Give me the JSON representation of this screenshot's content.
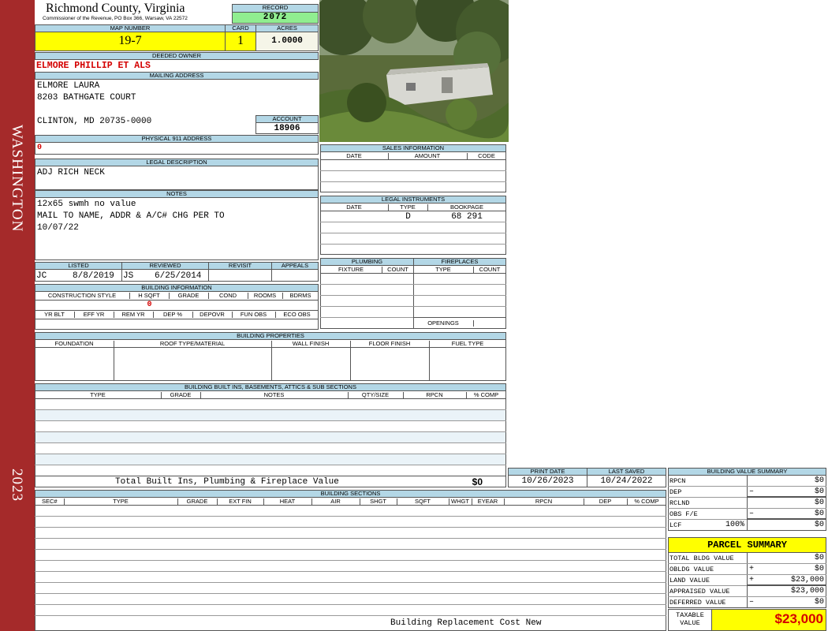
{
  "side_bar": {
    "district": "WASHINGTON",
    "year": "2023"
  },
  "header": {
    "county": "Richmond County, Virginia",
    "commissioner": "Commissioner of the Revenue, PO Box 366, Warsaw, VA 22572",
    "record_label": "RECORD",
    "record": "2072"
  },
  "parcel": {
    "map_label": "MAP NUMBER",
    "map": "19-7",
    "card_label": "CARD",
    "card": "1",
    "acres_label": "ACRES",
    "acres": "1.0000"
  },
  "owner": {
    "deeded_label": "DEEDED OWNER",
    "deeded": "ELMORE PHILLIP ET ALS",
    "mailing_label": "MAILING ADDRESS",
    "line1": "ELMORE LAURA",
    "line2": "8203 BATHGATE COURT",
    "line3": "CLINTON, MD 20735-0000",
    "account_label": "ACCOUNT",
    "account": "18906",
    "physical_label": "PHYSICAL 911 ADDRESS",
    "physical": "0"
  },
  "legal": {
    "label": "LEGAL DESCRIPTION",
    "text": "ADJ RICH NECK"
  },
  "notes": {
    "label": "NOTES",
    "line1": "12x65 swmh no value",
    "line2": "MAIL TO NAME, ADDR & A/C# CHG PER TO",
    "line3": "10/07/22"
  },
  "review": {
    "listed_label": "LISTED",
    "reviewed_label": "REVIEWED",
    "revisit_label": "REVISIT",
    "appeals_label": "APPEALS",
    "listed_by": "JC",
    "listed_date": "8/8/2019",
    "reviewed_by": "JS",
    "reviewed_date": "6/25/2014"
  },
  "building_info": {
    "label": "BUILDING INFORMATION",
    "cols1": [
      "CONSTRUCTION STYLE",
      "H SQFT",
      "GRADE",
      "COND",
      "ROOMS",
      "BDRMS"
    ],
    "hsqft": "0",
    "cols2": [
      "YR BLT",
      "EFF YR",
      "REM YR",
      "DEP %",
      "DEPOVR",
      "FUN OBS",
      "ECO OBS"
    ]
  },
  "sales": {
    "label": "SALES INFORMATION",
    "cols": [
      "DATE",
      "AMOUNT",
      "CODE"
    ]
  },
  "legal_instruments": {
    "label": "LEGAL INSTRUMENTS",
    "cols": [
      "DATE",
      "TYPE",
      "BOOKPAGE"
    ],
    "type": "D",
    "bookpage": "68 291"
  },
  "plumbing": {
    "label": "PLUMBING",
    "cols": [
      "FIXTURE",
      "COUNT"
    ]
  },
  "fireplaces": {
    "label": "FIREPLACES",
    "cols": [
      "TYPE",
      "COUNT"
    ],
    "openings": "OPENINGS"
  },
  "building_properties": {
    "label": "BUILDING PROPERTIES",
    "cols": [
      "FOUNDATION",
      "ROOF TYPE/MATERIAL",
      "WALL FINISH",
      "FLOOR FINISH",
      "FUEL TYPE"
    ]
  },
  "builtins": {
    "label": "BUILDING BUILT INS, BASEMENTS, ATTICS & SUB SECTIONS",
    "cols": [
      "TYPE",
      "GRADE",
      "NOTES",
      "QTY/SIZE",
      "RPCN",
      "% COMP"
    ]
  },
  "total_builtins": {
    "label": "Total Built Ins, Plumbing & Fireplace Value",
    "value": "$0"
  },
  "dates": {
    "print_label": "PRINT DATE",
    "print": "10/26/2023",
    "saved_label": "LAST SAVED",
    "saved": "10/24/2022"
  },
  "sections": {
    "label": "BUILDING SECTIONS",
    "cols": [
      "SEC#",
      "TYPE",
      "GRADE",
      "EXT FIN",
      "HEAT",
      "AIR",
      "SHGT",
      "SQFT",
      "WHGT",
      "EYEAR",
      "RPCN",
      "DEP",
      "% COMP"
    ],
    "footer": "Building Replacement Cost New"
  },
  "bvs": {
    "label": "BUILDING VALUE SUMMARY",
    "rows": [
      {
        "name": "RPCN",
        "sign": "",
        "value": "$0"
      },
      {
        "name": "DEP",
        "sign": "–",
        "value": "$0"
      },
      {
        "name": "RCLND",
        "sign": "",
        "value": "$0"
      },
      {
        "name": "OBS F/E",
        "sign": "–",
        "value": "$0"
      },
      {
        "name": "LCF",
        "extra": "100%",
        "sign": "",
        "value": "$0"
      }
    ]
  },
  "parcel_summary": {
    "label": "PARCEL SUMMARY",
    "rows": [
      {
        "name": "TOTAL BLDG VALUE",
        "sign": "",
        "value": "$0"
      },
      {
        "name": "OBLDG VALUE",
        "sign": "+",
        "value": "$0"
      },
      {
        "name": "LAND VALUE",
        "sign": "+",
        "value": "$23,000"
      },
      {
        "name": "APPRAISED VALUE",
        "sign": "",
        "value": "$23,000"
      },
      {
        "name": "DEFERRED VALUE",
        "sign": "–",
        "value": "$0"
      }
    ],
    "taxable_label1": "TAXABLE",
    "taxable_label2": "VALUE",
    "taxable": "$23,000"
  },
  "colors": {
    "sidebar": "#a52a2a",
    "header_fill": "#b3d7e6",
    "highlight": "#ffff00",
    "record_fill": "#90ee90"
  }
}
